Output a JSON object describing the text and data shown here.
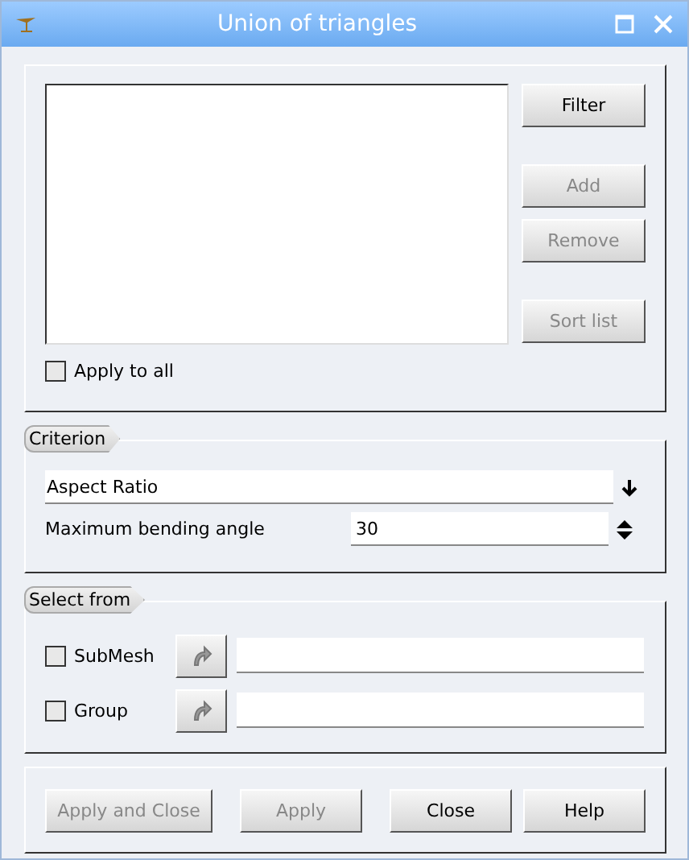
{
  "window": {
    "title": "Union of triangles"
  },
  "list_group": {
    "buttons": [
      {
        "label": "Filter",
        "disabled": false
      },
      {
        "label": "Add",
        "disabled": true
      },
      {
        "label": "Remove",
        "disabled": true
      },
      {
        "label": "Sort list",
        "disabled": true
      }
    ],
    "apply_to_all": {
      "label": "Apply to all",
      "checked": false
    }
  },
  "criterion": {
    "title": "Criterion",
    "combo": {
      "value": "Aspect Ratio"
    },
    "spin": {
      "label": "Maximum bending angle",
      "value": "30"
    }
  },
  "select_from": {
    "title": "Select from",
    "rows": [
      {
        "label": "SubMesh",
        "checked": false
      },
      {
        "label": "Group",
        "checked": false
      }
    ]
  },
  "footer_buttons": [
    {
      "label": "Apply and Close",
      "disabled": true
    },
    {
      "label": "Apply",
      "disabled": true
    },
    {
      "label": "Close",
      "disabled": false
    },
    {
      "label": "Help",
      "disabled": false
    }
  ]
}
